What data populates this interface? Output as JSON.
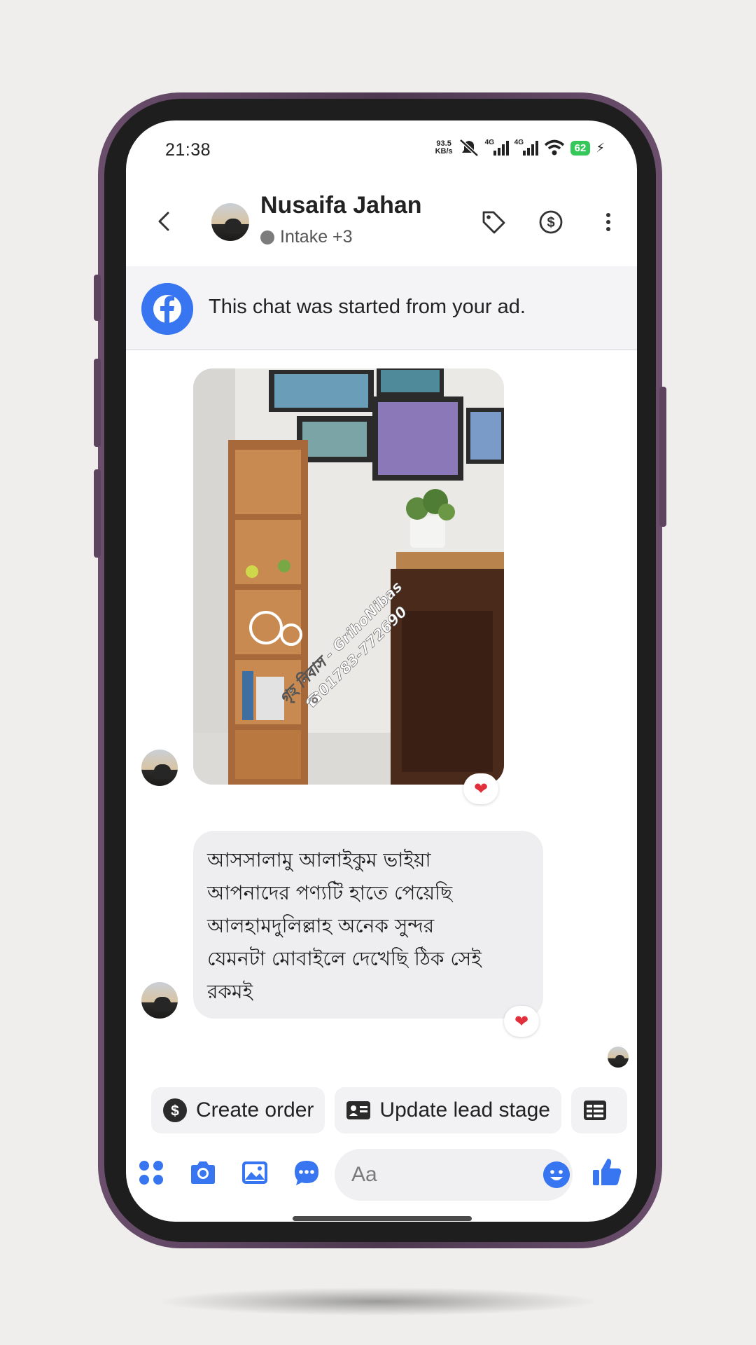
{
  "status_bar": {
    "time": "21:38",
    "net_speed_value": "93.5",
    "net_speed_unit": "KB/s",
    "network_1": "4G",
    "network_2": "4G",
    "battery": "62"
  },
  "header": {
    "contact_name": "Nusaifa Jahan",
    "contact_sub": "Intake +3",
    "icons": [
      "back-icon",
      "tag-icon",
      "dollar-icon",
      "more-icon"
    ]
  },
  "ad_banner": {
    "text": "This chat was started from your ad."
  },
  "messages": {
    "image_watermark_line1": "গৃহ নিবাস - GrihoNibas",
    "image_watermark_line2": "☎01783-772690",
    "text_lines": [
      "আসসালামু আলাইকুম ভাইয়া",
      "আপনাদের পণ্যটি হাতে পেয়েছি",
      "আলহামদুলিল্লাহ অনেক সুন্দর",
      "যেমনটা মোবাইলে দেখেছি ঠিক সেই",
      "রকমই"
    ],
    "reaction": "❤"
  },
  "quick_actions": [
    {
      "label": "Create order",
      "icon": "dollar-circle-icon"
    },
    {
      "label": "Update lead stage",
      "icon": "id-card-icon"
    },
    {
      "label": "",
      "icon": "table-icon"
    }
  ],
  "composer": {
    "placeholder": "Aa",
    "icons": [
      "apps-icon",
      "camera-icon",
      "gallery-icon",
      "chat-bubble-icon",
      "emoji-icon",
      "thumbs-up-icon"
    ]
  },
  "colors": {
    "accent": "#3776f0",
    "phone_frame": "#5a4160",
    "bubble": "#eeeef1",
    "reaction": "#e1303c"
  }
}
